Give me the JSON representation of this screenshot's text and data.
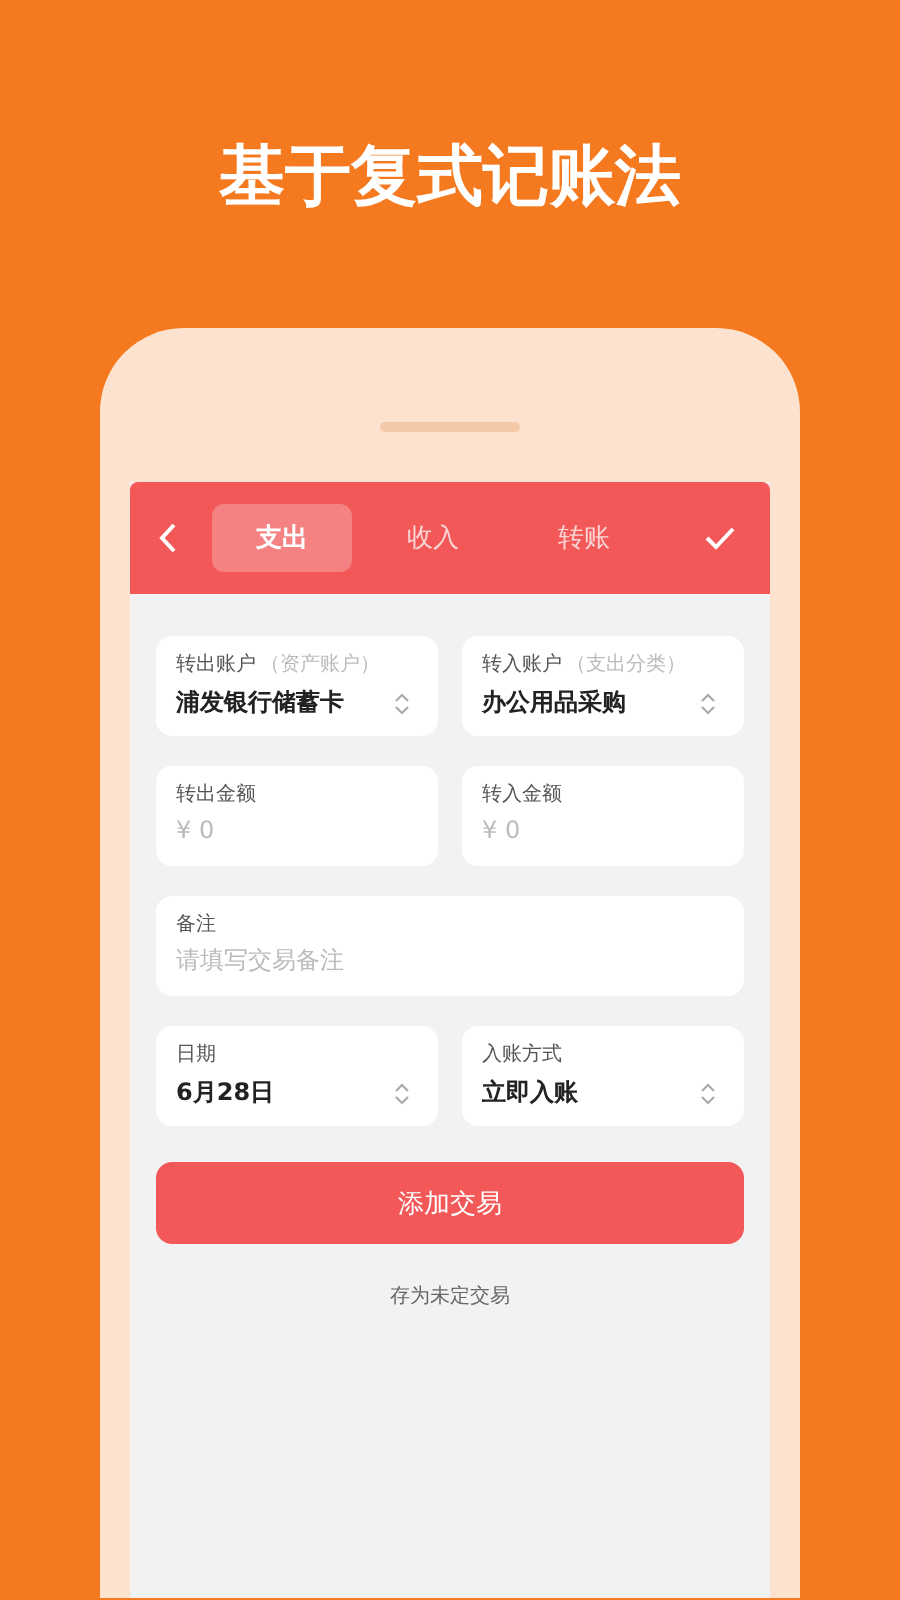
{
  "headline": "基于复式记账法",
  "toolbar": {
    "tabs": [
      {
        "label": "支出",
        "selected": true
      },
      {
        "label": "收入",
        "selected": false
      },
      {
        "label": "转账",
        "selected": false
      }
    ]
  },
  "fields": [
    {
      "kind": "select",
      "wide": false,
      "label": "转出账户",
      "hint": "（资产账户）",
      "value": "浦发银行储蓄卡"
    },
    {
      "kind": "select",
      "wide": false,
      "label": "转入账户",
      "hint": "（支出分类）",
      "value": "办公用品采购"
    },
    {
      "kind": "input",
      "wide": false,
      "label": "转出金额",
      "placeholder": "¥ 0"
    },
    {
      "kind": "input",
      "wide": false,
      "label": "转入金额",
      "placeholder": "¥ 0"
    },
    {
      "kind": "input",
      "wide": true,
      "label": "备注",
      "placeholder": "请填写交易备注"
    },
    {
      "kind": "select",
      "wide": false,
      "label": "日期",
      "value": "6月28日"
    },
    {
      "kind": "select",
      "wide": false,
      "label": "入账方式",
      "value": "立即入账"
    }
  ],
  "primary_button": "添加交易",
  "secondary_link": "存为未定交易"
}
